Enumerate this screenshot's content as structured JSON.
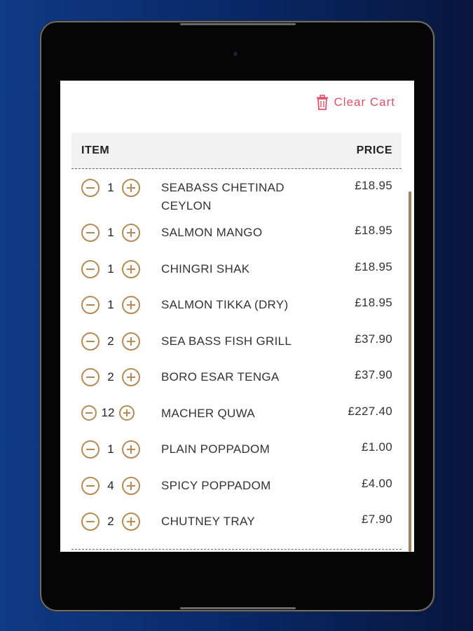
{
  "cart": {
    "clear_label": "Clear Cart",
    "header": {
      "item": "ITEM",
      "price": "PRICE"
    },
    "items": [
      {
        "qty": "1",
        "name": "SEABASS CHETINAD CEYLON",
        "price": "£18.95"
      },
      {
        "qty": "1",
        "name": "SALMON MANGO",
        "price": "£18.95"
      },
      {
        "qty": "1",
        "name": "CHINGRI SHAK",
        "price": "£18.95"
      },
      {
        "qty": "1",
        "name": "SALMON TIKKA (DRY)",
        "price": "£18.95"
      },
      {
        "qty": "2",
        "name": "SEA BASS FISH GRILL",
        "price": "£37.90"
      },
      {
        "qty": "2",
        "name": "BORO ESAR TENGA",
        "price": "£37.90"
      },
      {
        "qty": "12",
        "name": "MACHER QUWA",
        "price": "£227.40"
      },
      {
        "qty": "1",
        "name": "PLAIN POPPADOM",
        "price": "£1.00"
      },
      {
        "qty": "4",
        "name": "SPICY POPPADOM",
        "price": "£4.00"
      },
      {
        "qty": "2",
        "name": "CHUTNEY TRAY",
        "price": "£7.90"
      }
    ]
  },
  "colors": {
    "accent": "#b48a55",
    "clear": "#e0506a"
  },
  "icons": {
    "clear": "trash-icon",
    "decrease": "minus-circle-icon",
    "increase": "plus-circle-icon"
  }
}
